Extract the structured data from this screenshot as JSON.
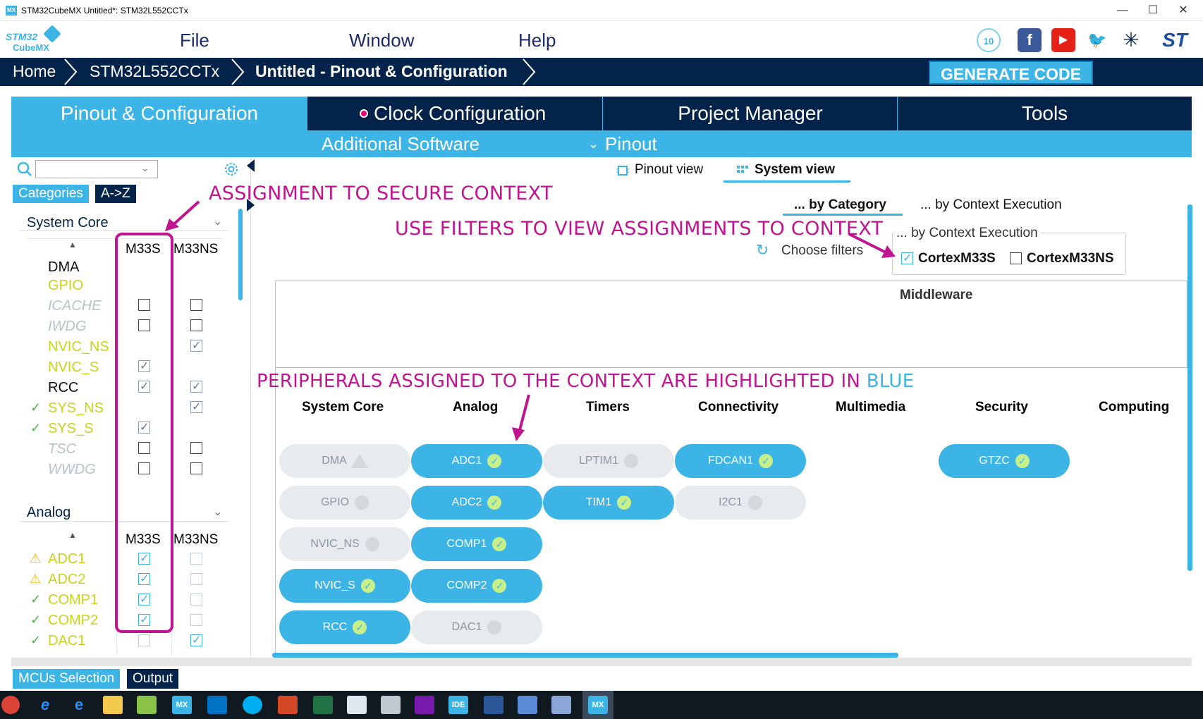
{
  "window": {
    "title": "STM32CubeMX Untitled*: STM32L552CCTx",
    "app_badge": "MX"
  },
  "logo": {
    "line1": "STM32",
    "line2": "CubeMX"
  },
  "menu": {
    "file": "File",
    "window": "Window",
    "help": "Help"
  },
  "social": {
    "anniv": "10",
    "facebook": "f",
    "youtube": "▶",
    "twitter": "🐦",
    "network": "✳",
    "st": "ST"
  },
  "breadcrumb": {
    "home": "Home",
    "mcu": "STM32L552CCTx",
    "project": "Untitled - Pinout & Configuration"
  },
  "generate_label": "GENERATE CODE",
  "tabs": {
    "pinout": "Pinout & Configuration",
    "clock": "Clock Configuration",
    "project": "Project Manager",
    "tools": "Tools"
  },
  "subtabs": {
    "additional": "Additional Software",
    "pinout": "Pinout"
  },
  "left": {
    "cat_tab": "Categories",
    "az_tab": "A->Z",
    "system_core": "System Core",
    "col_s": "M33S",
    "col_ns": "M33NS",
    "sys_items": [
      {
        "name": "DMA"
      },
      {
        "name": "GPIO"
      },
      {
        "name": "ICACHE"
      },
      {
        "name": "IWDG"
      },
      {
        "name": "NVIC_NS"
      },
      {
        "name": "NVIC_S"
      },
      {
        "name": "RCC"
      },
      {
        "name": "SYS_NS"
      },
      {
        "name": "SYS_S"
      },
      {
        "name": "TSC"
      },
      {
        "name": "WWDG"
      }
    ],
    "analog": "Analog",
    "analog_items": [
      {
        "name": "ADC1"
      },
      {
        "name": "ADC2"
      },
      {
        "name": "COMP1"
      },
      {
        "name": "COMP2"
      },
      {
        "name": "DAC1"
      }
    ]
  },
  "annotations": {
    "a1": "ASSIGNMENT TO SECURE CONTEXT",
    "a2": "USE FILTERS TO VIEW ASSIGNMENTS TO CONTEXT",
    "a3": "PERIPHERALS ASSIGNED TO THE CONTEXT ARE HIGHLIGHTED IN",
    "a3_blue": "BLUE"
  },
  "main": {
    "pinout_view": "Pinout view",
    "system_view": "System view",
    "by_category": "... by Category",
    "by_context": "... by Context Execution",
    "filter_legend": "... by Context Execution",
    "choose_filters": "Choose filters",
    "filter_s": "CortexM33S",
    "filter_ns": "CortexM33NS",
    "middleware": "Middleware",
    "columns": [
      "System Core",
      "Analog",
      "Timers",
      "Connectivity",
      "Multimedia",
      "Security",
      "Computing"
    ],
    "pills": {
      "dma": "DMA",
      "gpio": "GPIO",
      "nvic_ns": "NVIC_NS",
      "nvic_s": "NVIC_S",
      "rcc": "RCC",
      "adc1": "ADC1",
      "adc2": "ADC2",
      "comp1": "COMP1",
      "comp2": "COMP2",
      "dac1": "DAC1",
      "lptim1": "LPTIM1",
      "tim1": "TIM1",
      "fdcan1": "FDCAN1",
      "i2c1": "I2C1",
      "gtzc": "GTZC"
    }
  },
  "bottom": {
    "mcu_sel": "MCUs Selection",
    "output": "Output"
  },
  "taskbar": {
    "mx1": "MX",
    "mx2": "MX",
    "ide": "IDE"
  }
}
